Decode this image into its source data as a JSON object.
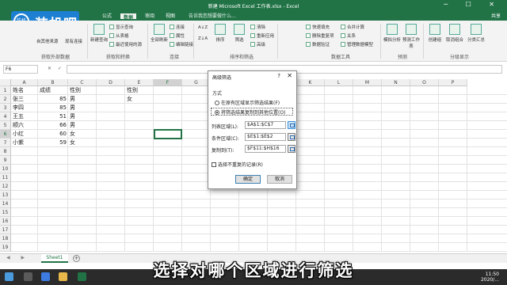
{
  "window": {
    "title": "新建 Microsoft Excel 工作表.xlsx - Excel",
    "controls": "─ ☐ ✕"
  },
  "logo": {
    "badge": "装机吧",
    "text": "装机吧"
  },
  "ribbon": {
    "tabs": [
      {
        "label": "公式"
      },
      {
        "label": "数据",
        "active": true
      },
      {
        "label": "审阅"
      },
      {
        "label": "视图"
      }
    ],
    "tell_me": "告诉我您想要做什么...",
    "share": "共享",
    "buttons": {
      "from_other": "自其他来源",
      "existing": "现有连接",
      "new_query": "新建查询",
      "show_queries": "显示查询",
      "from_table": "从表格",
      "recent": "最近使用的源",
      "refresh_all": "全部刷新",
      "connections": "连接",
      "properties": "属性",
      "edit_links": "编辑链接",
      "sort_asc": "A↓Z",
      "sort_desc": "Z↓A",
      "sort": "排序",
      "filter": "筛选",
      "clear": "清除",
      "reapply": "重新应用",
      "advanced": "高级",
      "quick_fill": "快速填充",
      "remove_dup": "删除重复项",
      "validation": "数据验证",
      "consolidate": "合并计算",
      "relationships": "关系",
      "data_model": "管理数据模型",
      "what_if": "模拟分析",
      "forecast": "预测工作表",
      "group": "创建组",
      "ungroup": "取消组合",
      "subtotal": "分类汇总"
    },
    "groups": [
      "获取外部数据",
      "获取和转换",
      "连接",
      "排序和筛选",
      "数据工具",
      "预测",
      "分级显示"
    ]
  },
  "formula_bar": {
    "name_box": "F6",
    "fx": "✕ ✓ fx",
    "formula": ""
  },
  "sheet": {
    "columns": [
      "A",
      "B",
      "C",
      "D",
      "E",
      "F",
      "G",
      "H",
      "I",
      "J",
      "K",
      "L",
      "M",
      "N",
      "O",
      "P"
    ],
    "rows": [
      "1",
      "2",
      "3",
      "4",
      "5",
      "6",
      "7",
      "8",
      "9",
      "10",
      "11",
      "12",
      "13",
      "14",
      "15",
      "16",
      "17",
      "18",
      "19"
    ],
    "cells": {
      "A1": "姓名",
      "B1": "成绩",
      "C1": "性别",
      "E1": "性别",
      "A2": "张三",
      "B2": "85",
      "C2": "男",
      "E2": "女",
      "A3": "李四",
      "B3": "85",
      "C3": "男",
      "A4": "王五",
      "B4": "51",
      "C4": "男",
      "A5": "顺六",
      "B5": "66",
      "C5": "男",
      "A6": "小红",
      "B6": "60",
      "C6": "女",
      "A7": "小紫",
      "B7": "59",
      "C7": "女"
    },
    "active_cell": "F6"
  },
  "dialog": {
    "title": "高级筛选",
    "help": "?",
    "close": "✕",
    "section": "方式",
    "option1": "在原有区域显示筛选结果(F)",
    "option2": "将筛选结果复制到其他位置(O)",
    "list_range_label": "列表区域(L):",
    "list_range": "$A$1:$C$7",
    "criteria_label": "条件区域(C):",
    "criteria": "$E$1:$E$2",
    "copy_to_label": "复制到(T):",
    "copy_to": "$F$11:$H$16",
    "unique_label": "选择不重复的记录(R)",
    "ok": "确定",
    "cancel": "取消"
  },
  "sheet_tabs": {
    "nav": "◀ ▶",
    "active": "Sheet1",
    "add": "+"
  },
  "caption": "选择对哪个区域进行筛选",
  "taskbar": {
    "time": "11:50",
    "date": "2020/..."
  }
}
